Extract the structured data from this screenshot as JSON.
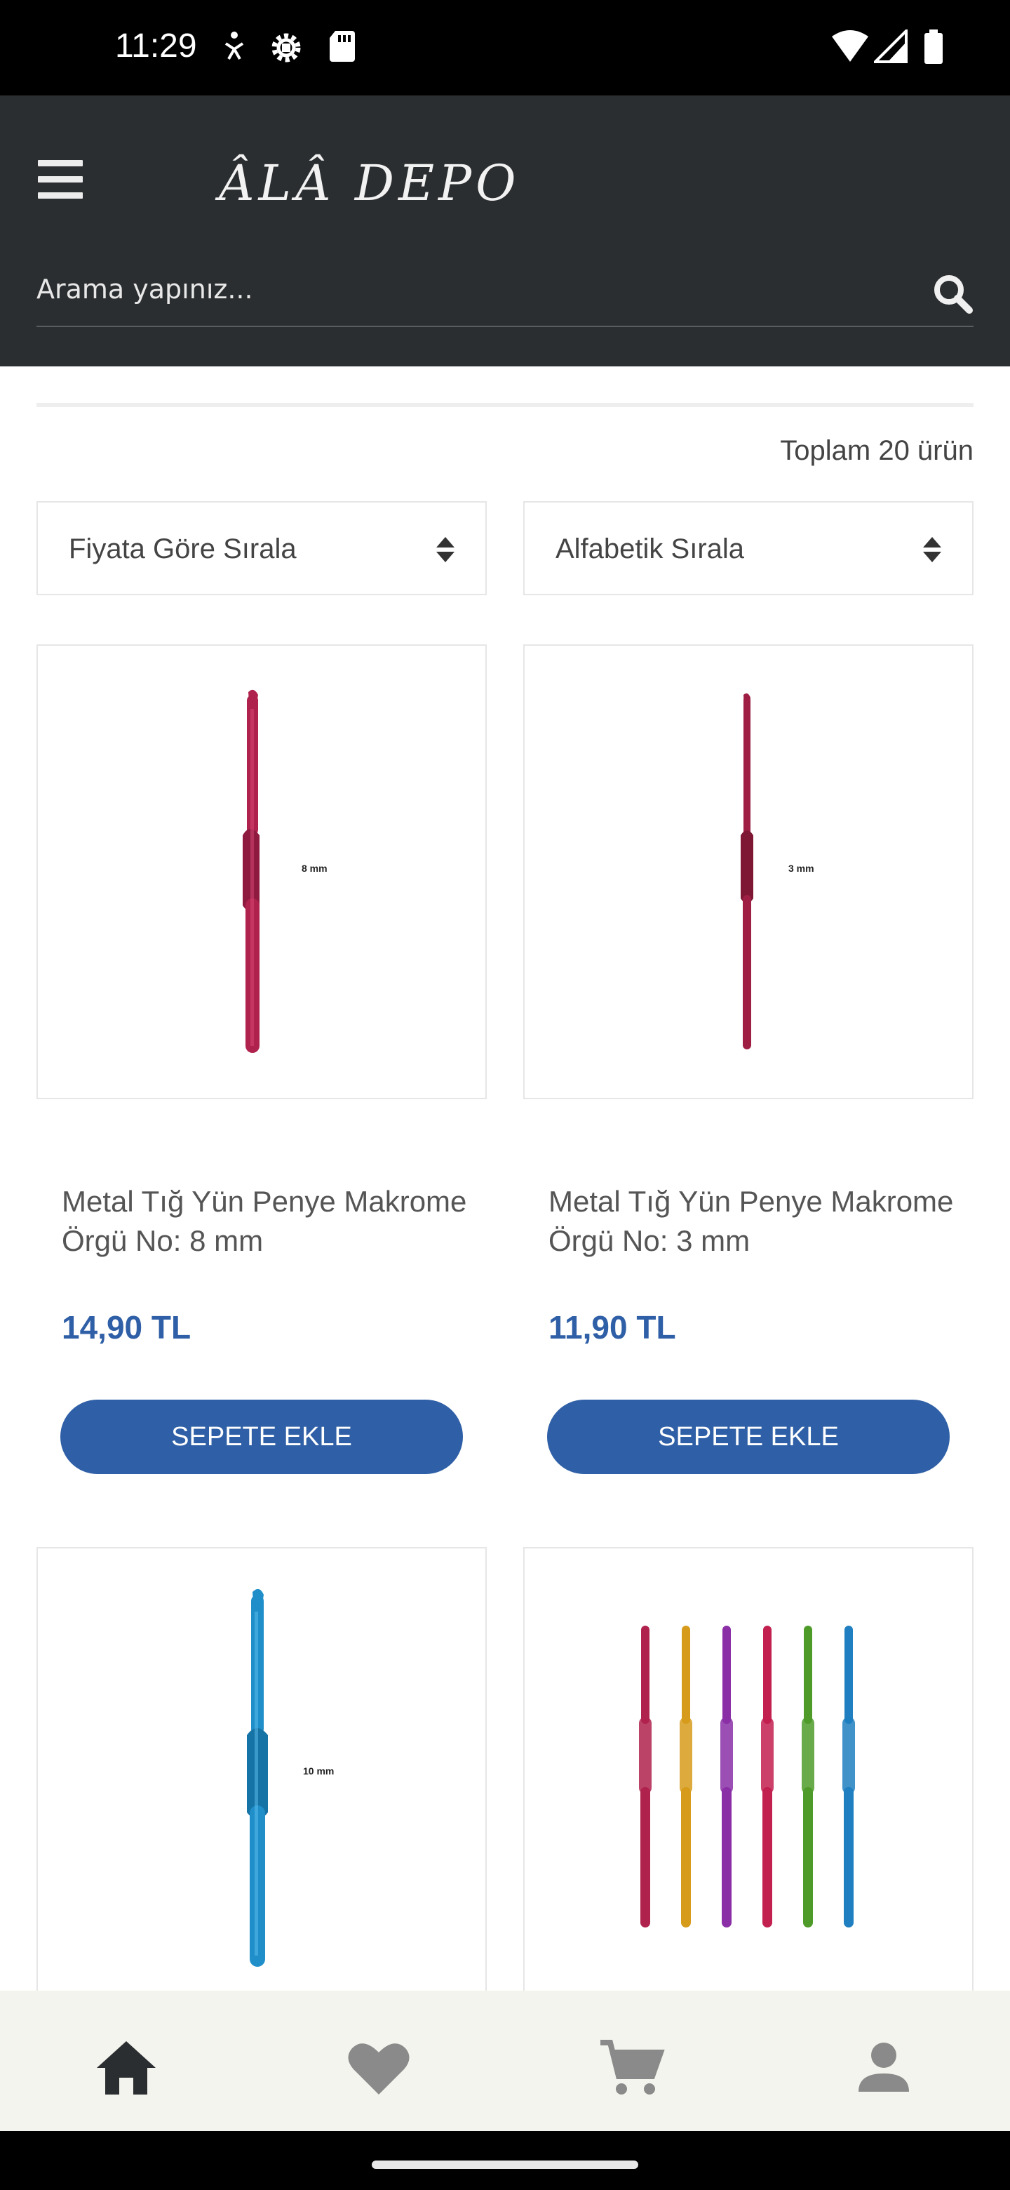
{
  "status_bar": {
    "time": "11:29"
  },
  "header": {
    "logo_text": "ÂLÂ DEPO",
    "search_placeholder": "Arama yapınız..."
  },
  "listing": {
    "total_text": "Toplam 20 ürün",
    "sort_price_label": "Fiyata Göre Sırala",
    "sort_alpha_label": "Alfabetik Sırala"
  },
  "products": [
    {
      "name": "Metal Tığ Yün Penye Makrome Örgü No: 8 mm",
      "price": "14,90 TL",
      "button_label": "SEPETE EKLE",
      "image_label": "8 mm",
      "hook_color": "#b0224e"
    },
    {
      "name": "Metal Tığ Yün Penye Makrome Örgü No: 3 mm",
      "price": "11,90 TL",
      "button_label": "SEPETE EKLE",
      "image_label": "3 mm",
      "hook_color": "#9e1f43"
    },
    {
      "image_label": "10 mm",
      "hook_color": "#1f8ec9"
    },
    {
      "hook_colors": [
        "#b0224e",
        "#d79b1c",
        "#8a2fa6",
        "#c2204f",
        "#4f9b2a",
        "#1f7fc0"
      ]
    }
  ],
  "colors": {
    "header_bg": "#2b2e30",
    "accent": "#2f5fa6",
    "nav_bg": "#f4f4ee"
  },
  "bottom_nav": {
    "items": [
      "home-icon",
      "heart-icon",
      "cart-icon",
      "person-icon"
    ]
  }
}
